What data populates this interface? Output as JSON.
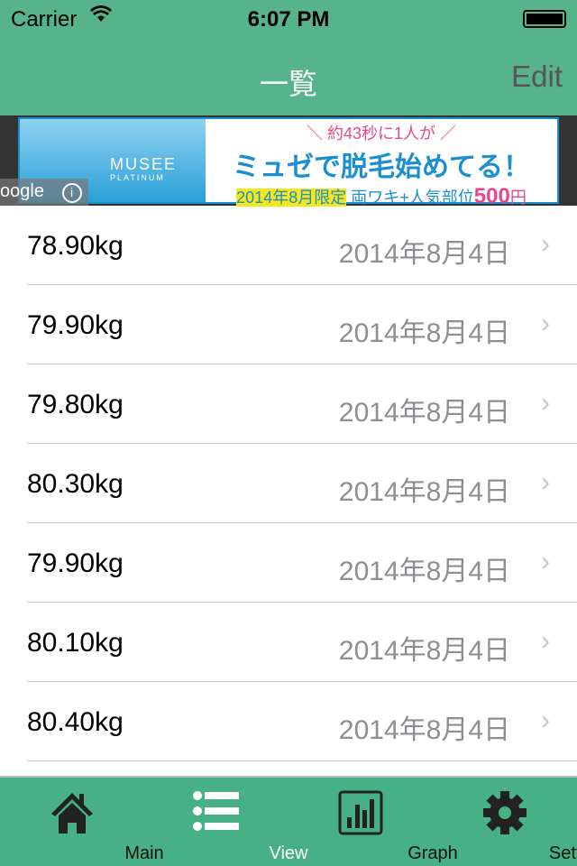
{
  "status": {
    "carrier": "Carrier",
    "time": "6:07 PM"
  },
  "nav": {
    "title": "一覧",
    "edit_label": "Edit"
  },
  "ad": {
    "brand": "MUSEE",
    "brand_sub": "PLATINUM",
    "line1": "＼ 約43秒に1人が ／",
    "line2": "ミュゼで脱毛始めてる！",
    "highlight": "2014年8月限定",
    "line3": "両ワキ+人気部位",
    "price": "500",
    "yen": "円",
    "google": "oogle"
  },
  "rows": [
    {
      "weight": "78.90kg",
      "date": "2014年8月4日"
    },
    {
      "weight": "79.90kg",
      "date": "2014年8月4日"
    },
    {
      "weight": "79.80kg",
      "date": "2014年8月4日"
    },
    {
      "weight": "80.30kg",
      "date": "2014年8月4日"
    },
    {
      "weight": "79.90kg",
      "date": "2014年8月4日"
    },
    {
      "weight": "80.10kg",
      "date": "2014年8月4日"
    },
    {
      "weight": "80.40kg",
      "date": "2014年8月4日"
    }
  ],
  "tabs": [
    {
      "label": "Main",
      "icon": "home-icon"
    },
    {
      "label": "View",
      "icon": "list-icon",
      "active": true
    },
    {
      "label": "Graph",
      "icon": "bar-chart-icon"
    },
    {
      "label": "Setting",
      "icon": "gear-icon"
    }
  ],
  "colors": {
    "header": "#56b38a",
    "tabbar": "#47b085"
  }
}
